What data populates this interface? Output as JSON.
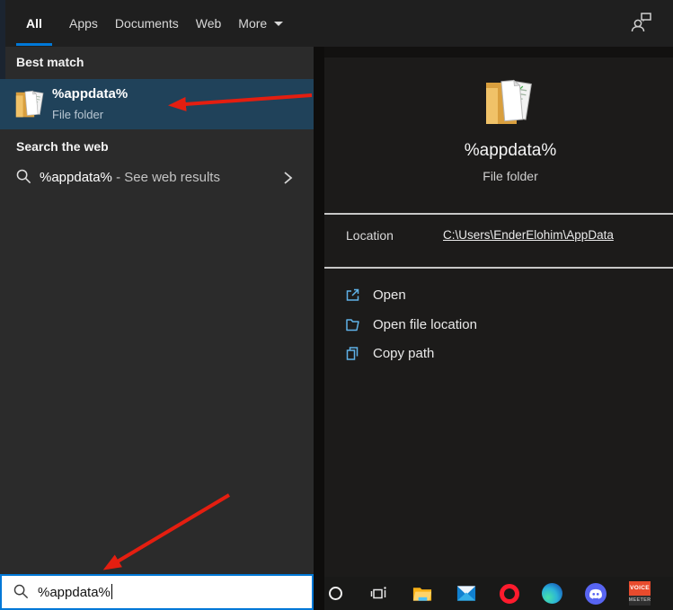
{
  "colors": {
    "accent": "#0078d7",
    "highlight_row": "#20425a",
    "arrow_red": "#e41e10",
    "action_icon_blue": "#5fb2e8",
    "left_panel_bg": "#2b2b2b",
    "right_panel_bg": "#1c1b1a",
    "topbar_bg": "#1f1f1f"
  },
  "topbar": {
    "tabs": [
      {
        "label": "All",
        "active": true
      },
      {
        "label": "Apps",
        "active": false
      },
      {
        "label": "Documents",
        "active": false
      },
      {
        "label": "Web",
        "active": false
      },
      {
        "label": "More",
        "active": false,
        "has_dropdown": true
      }
    ],
    "user_icon": "person-chat-icon"
  },
  "left_panel": {
    "best_match_header": "Best match",
    "best_match": {
      "icon": "folder-documents-icon",
      "title": "%appdata%",
      "subtitle": "File folder"
    },
    "search_web_header": "Search the web",
    "web_result": {
      "icon": "search-icon",
      "query": "%appdata%",
      "suffix": "- See web results",
      "chevron": "chevron-right-icon"
    }
  },
  "preview": {
    "icon": "folder-documents-icon",
    "title": "%appdata%",
    "subtitle": "File folder",
    "location_label": "Location",
    "location_value": "C:\\Users\\EnderElohim\\AppData",
    "actions": [
      {
        "icon": "open-external-icon",
        "label": "Open"
      },
      {
        "icon": "folder-outline-icon",
        "label": "Open file location"
      },
      {
        "icon": "copy-pages-icon",
        "label": "Copy path"
      }
    ]
  },
  "search_box": {
    "icon": "search-icon",
    "value": "%appdata%"
  },
  "taskbar": {
    "icons": [
      "cortana",
      "task-view",
      "file-explorer",
      "mail",
      "opera",
      "edge",
      "discord",
      "voicemeeter"
    ],
    "voicemeeter_line1": "VOICE",
    "voicemeeter_line2": "MEETER"
  }
}
